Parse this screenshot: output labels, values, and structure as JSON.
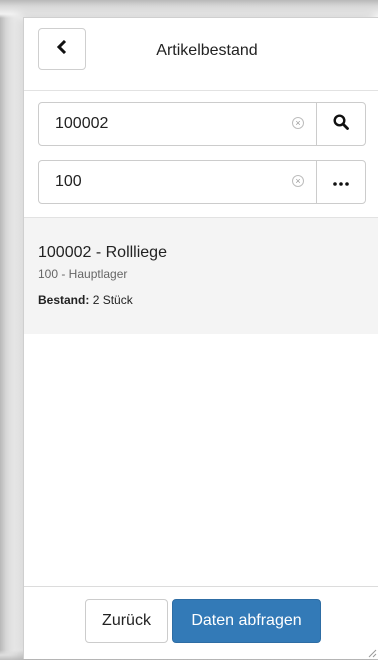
{
  "header": {
    "title": "Artikelbestand",
    "back_icon": "chevron-left-icon"
  },
  "search": {
    "article_value": "100002",
    "article_search_icon": "search-icon",
    "warehouse_value": "100",
    "warehouse_more_icon": "ellipsis-icon",
    "clear_icon": "clear-icon",
    "clear_glyph": "×"
  },
  "result": {
    "title": "100002 - Rollliege",
    "warehouse": "100 - Hauptlager",
    "stock_label": "Bestand:",
    "stock_value": "2 Stück"
  },
  "footer": {
    "back_label": "Zurück",
    "query_label": "Daten abfragen"
  },
  "colors": {
    "primary": "#337ab7",
    "result_background": "#f4f4f4"
  }
}
